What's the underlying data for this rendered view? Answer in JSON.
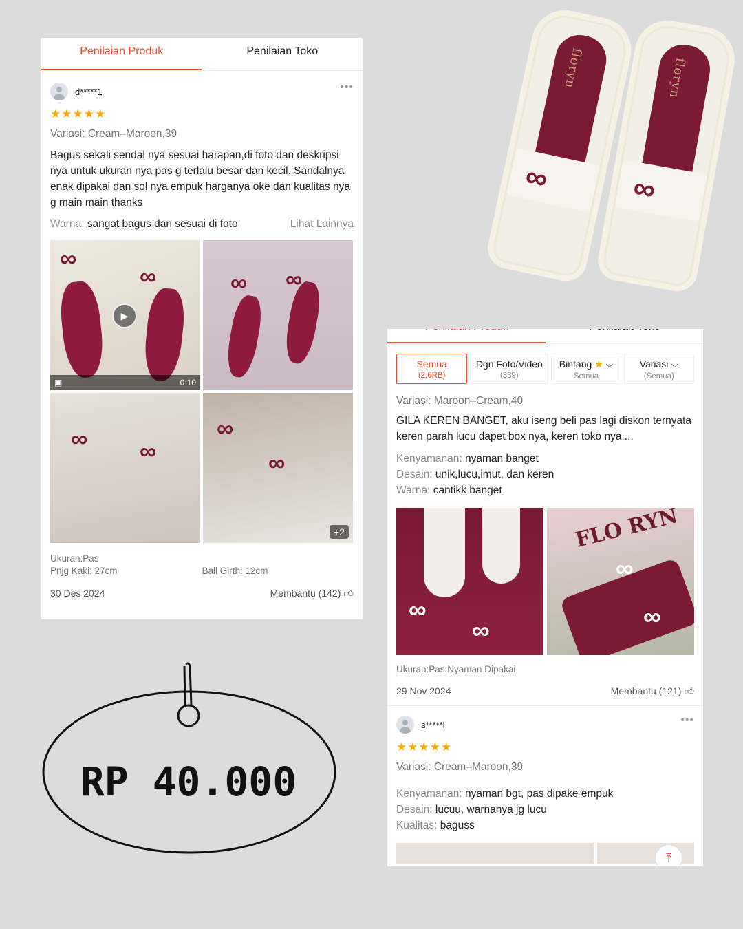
{
  "tabs": [
    "Penilaian Produk",
    "Penilaian Toko"
  ],
  "review1": {
    "username": "d*****1",
    "more": "•••",
    "stars": "★★★★★",
    "variasi": "Variasi: Cream–Maroon,39",
    "text": "Bagus sekali sendal nya sesuai harapan,di foto dan deskripsi nya untuk ukuran nya pas g terlalu besar dan kecil. Sandalnya enak dipakai dan sol nya empuk harganya oke dan kualitas nya g main main thanks",
    "warna_label": "Warna:",
    "warna_value": "sangat bagus dan sesuai di foto",
    "lihat": "Lihat Lainnya",
    "video_duration": "0:10",
    "more_photos": "+2",
    "ukuran": "Ukuran:Pas",
    "panjang_kaki": "Pnjg Kaki: 27cm",
    "ball_girth": "Ball Girth: 12cm",
    "date": "30 Des 2024",
    "helpful": "Membantu (142)"
  },
  "filters": [
    {
      "label": "Semua",
      "sub": "(2,6RB)"
    },
    {
      "label": "Dgn Foto/Video",
      "sub": "(339)"
    },
    {
      "label": "Bintang",
      "sub": "Semua"
    },
    {
      "label": "Variasi",
      "sub": "(Semua)"
    }
  ],
  "review2": {
    "variasi": "Variasi: Maroon–Cream,40",
    "text": "GILA KEREN BANGET, aku iseng beli pas lagi diskon ternyata keren parah lucu dapet box nya, keren toko nya....",
    "kenyamanan_label": "Kenyamanan:",
    "kenyamanan_value": "nyaman banget",
    "desain_label": "Desain:",
    "desain_value": "unik,lucu,imut, dan keren",
    "warna_label": "Warna:",
    "warna_value": "cantikk banget",
    "box_label": "FLO RYN",
    "ukuran": "Ukuran:Pas,Nyaman Dipakai",
    "date": "29 Nov 2024",
    "helpful": "Membantu (121)"
  },
  "review3": {
    "username": "s*****i",
    "more": "•••",
    "stars": "★★★★★",
    "variasi": "Variasi: Cream–Maroon,39",
    "kenyamanan_label": "Kenyamanan:",
    "kenyamanan_value": "nyaman bgt, pas dipake empuk",
    "desain_label": "Desain:",
    "desain_value": "lucuu, warnanya jg lucu",
    "kualitas_label": "Kualitas:",
    "kualitas_value": "baguss"
  },
  "product": {
    "brand": "floryn"
  },
  "price": "RP 40.000",
  "colors": {
    "accent": "#ee4d2d",
    "star": "#f6a700",
    "maroon": "#7b1a33",
    "background": "#dcdcdc"
  }
}
